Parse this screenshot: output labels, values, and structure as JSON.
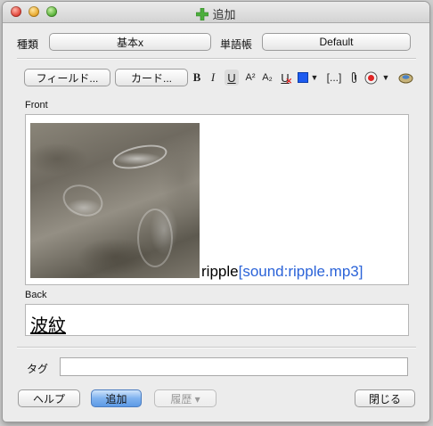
{
  "window": {
    "title": "追加"
  },
  "type_row": {
    "type_label": "種類",
    "type_value": "基本x",
    "deck_label": "単語帳",
    "deck_value": "Default"
  },
  "toolbar": {
    "fields_button": "フィールド...",
    "cards_button": "カード...",
    "bold": "B",
    "italic": "I",
    "underline": "U",
    "superscript": "A²",
    "subscript": "A₂",
    "clear_format": "U",
    "cloze": "[...]",
    "text_color": "#1d5bf0"
  },
  "fields": {
    "front_label": "Front",
    "front_word": "ripple",
    "front_sound": "[sound:ripple.mp3]",
    "back_label": "Back",
    "back_value": "波紋"
  },
  "tags": {
    "label": "タグ",
    "value": ""
  },
  "bottom": {
    "help_button": "ヘルプ",
    "add_button": "追加",
    "history_button": "履歴 ▾",
    "close_button": "閉じる"
  }
}
